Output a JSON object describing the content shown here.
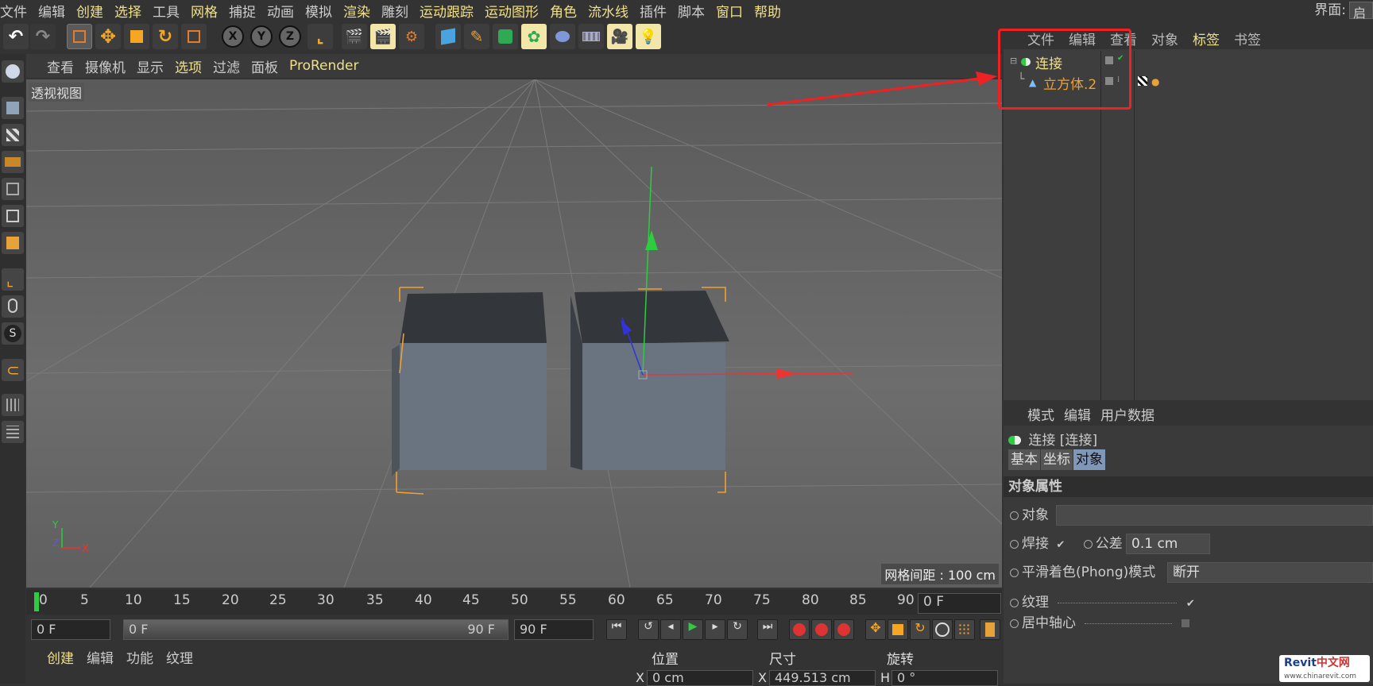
{
  "menubar": {
    "items": [
      "文件",
      "编辑",
      "创建",
      "选择",
      "工具",
      "网格",
      "捕捉",
      "动画",
      "模拟",
      "渲染",
      "雕刻",
      "运动跟踪",
      "运动图形",
      "角色",
      "流水线",
      "插件",
      "脚本",
      "窗口",
      "帮助"
    ],
    "highlighted": [
      2,
      3,
      5,
      9,
      11,
      12,
      13,
      14,
      17,
      18
    ],
    "layout_label": "界面:",
    "layout_value": "启"
  },
  "toolbar": {
    "axis_x": "X",
    "axis_y": "Y",
    "axis_z": "Z"
  },
  "viewport_menu": {
    "items": [
      "查看",
      "摄像机",
      "显示",
      "选项",
      "过滤",
      "面板",
      "ProRender"
    ],
    "highlighted": [
      3,
      6
    ]
  },
  "viewport": {
    "label": "透视视图",
    "grid_spacing": "网格间距 : 100 cm",
    "axis_x": "X",
    "axis_y": "Y",
    "axis_z": "Z"
  },
  "timeline": {
    "ticks": [
      "0",
      "5",
      "10",
      "15",
      "20",
      "25",
      "30",
      "35",
      "40",
      "45",
      "50",
      "55",
      "60",
      "65",
      "70",
      "75",
      "80",
      "85",
      "90"
    ],
    "current": "0 F"
  },
  "transport": {
    "start": "0 F",
    "range_start": "0 F",
    "range_end": "90 F",
    "end": "90 F"
  },
  "material_menu": {
    "items": [
      "创建",
      "编辑",
      "功能",
      "纹理"
    ],
    "highlighted": [
      0
    ]
  },
  "coords": {
    "position": "位置",
    "size": "尺寸",
    "rotation": "旋转",
    "x_label": "X",
    "x_value": "0 cm",
    "sx_label": "X",
    "sx_value": "449.513 cm",
    "h_label": "H",
    "h_value": "0 °"
  },
  "object_manager": {
    "menu": [
      "文件",
      "编辑",
      "查看",
      "对象",
      "标签",
      "书签"
    ],
    "highlighted": [
      4
    ],
    "objects": [
      {
        "name": "连接"
      },
      {
        "name": "立方体.2"
      }
    ]
  },
  "attribute_manager": {
    "menu": [
      "模式",
      "编辑",
      "用户数据"
    ],
    "title": "连接 [连接]",
    "tabs": [
      "基本",
      "坐标",
      "对象"
    ],
    "active_tab": 2,
    "section": "对象属性",
    "fields": {
      "object_label": "对象",
      "weld_label": "焊接",
      "tolerance_label": "公差",
      "tolerance_value": "0.1 cm",
      "phong_label": "平滑着色(Phong)模式",
      "phong_value": "断开",
      "texture_label": "纹理",
      "center_label": "居中轴心"
    }
  },
  "watermark": {
    "brand_a": "Revit",
    "brand_b": "中文网",
    "url": "www.chinarevit.com"
  },
  "colors": {
    "accent": "#f0e08a",
    "selected_tab": "#7f97b8",
    "annotation": "#ee2222"
  }
}
